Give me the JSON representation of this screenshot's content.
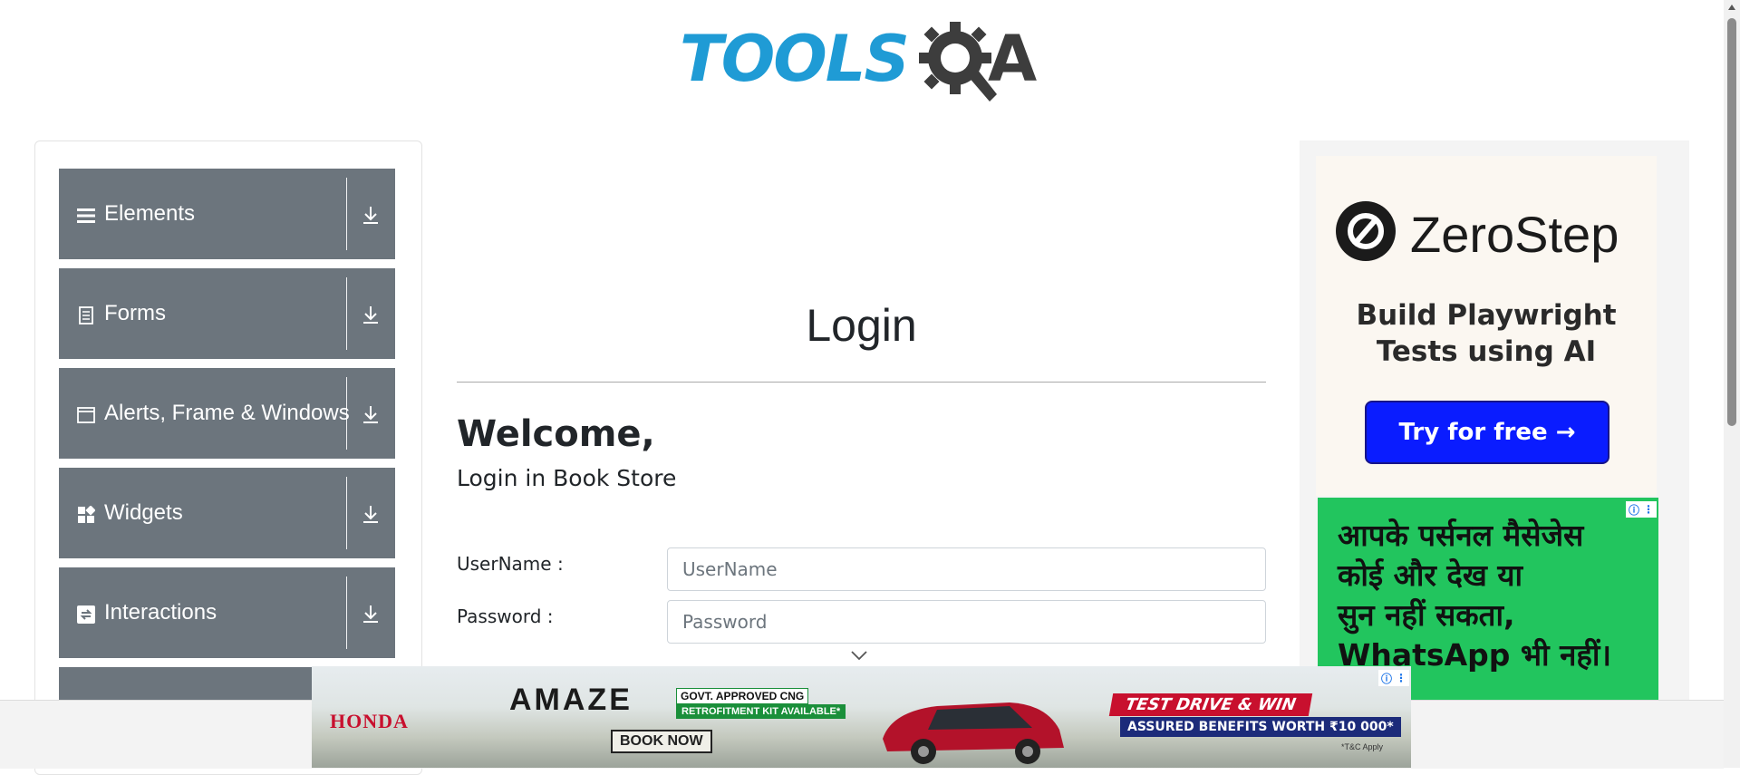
{
  "header": {
    "logo_text_left": "TOOLS",
    "logo_text_right": "A"
  },
  "sidebar": {
    "items": [
      {
        "label": "Elements",
        "icon": "hamburger-icon"
      },
      {
        "label": "Forms",
        "icon": "document-icon"
      },
      {
        "label": "Alerts, Frame & Windows",
        "icon": "window-icon"
      },
      {
        "label": "Widgets",
        "icon": "widgets-icon"
      },
      {
        "label": "Interactions",
        "icon": "interactions-icon"
      }
    ]
  },
  "main": {
    "title": "Login",
    "welcome": "Welcome,",
    "subtitle": "Login in Book Store",
    "username_label": "UserName :",
    "username_placeholder": "UserName",
    "password_label": "Password :",
    "password_placeholder": "Password"
  },
  "ads": {
    "zerostep": {
      "name": "ZeroStep",
      "tagline_line1": "Build Playwright",
      "tagline_line2": "Tests using AI",
      "button": "Try for free →"
    },
    "whatsapp": {
      "line1": "आपके पर्सनल मैसेजेस",
      "line2": "कोई और देख या",
      "line3": "सुन नहीं सकता,",
      "line4": "WhatsApp भी नहीं।"
    },
    "honda": {
      "brand": "HONDA",
      "model": "AMAZE",
      "govt": "GOVT. APPROVED CNG",
      "kit": "RETROFITMENT KIT AVAILABLE*",
      "book": "BOOK NOW",
      "test_drive": "TEST DRIVE & WIN",
      "benefits": "ASSURED BENEFITS WORTH ₹10 000*",
      "tc": "*T&C Apply"
    }
  },
  "colors": {
    "nav_bg": "#6c757d",
    "logo_blue": "#1f9bd5",
    "ad_green": "#22c55e",
    "try_button": "#0a1cff"
  }
}
